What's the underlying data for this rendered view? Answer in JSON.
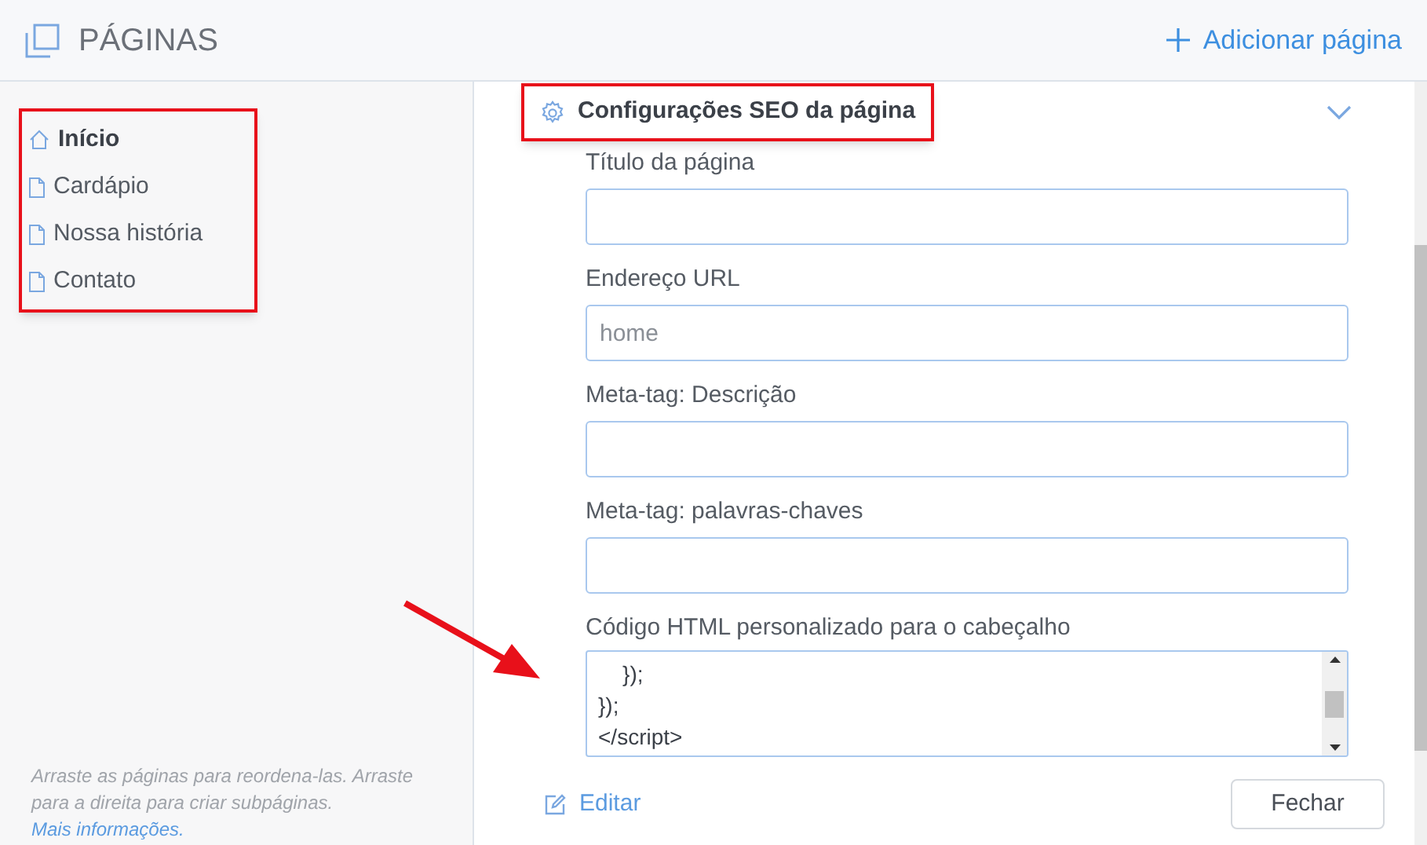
{
  "header": {
    "title": "PÁGINAS",
    "add_button": "Adicionar página"
  },
  "pages": {
    "highlighted": true,
    "items": [
      {
        "label": "Início",
        "kind": "home",
        "selected": true
      },
      {
        "label": "Cardápio",
        "kind": "page",
        "selected": false
      },
      {
        "label": "Nossa história",
        "kind": "page",
        "selected": false
      },
      {
        "label": "Contato",
        "kind": "page",
        "selected": false
      }
    ]
  },
  "help": {
    "text": "Arraste as páginas para reordena-las. Arraste para a direita para criar subpáginas.",
    "link": "Mais informações."
  },
  "seo": {
    "title": "Configurações SEO da página",
    "highlighted": true,
    "expanded": true,
    "fields": [
      {
        "label": "Título da página"
      },
      {
        "label": "Endereço URL",
        "value": "home"
      },
      {
        "label": "Meta-tag: Descrição"
      },
      {
        "label": "Meta-tag: palavras-chaves"
      }
    ],
    "code": {
      "label": "Código HTML personalizado para o cabeçalho",
      "lines": [
        "    });",
        "});",
        "</script>"
      ]
    }
  },
  "annotation_arrow": true,
  "footer": {
    "edit": "Editar",
    "close": "Fechar"
  }
}
